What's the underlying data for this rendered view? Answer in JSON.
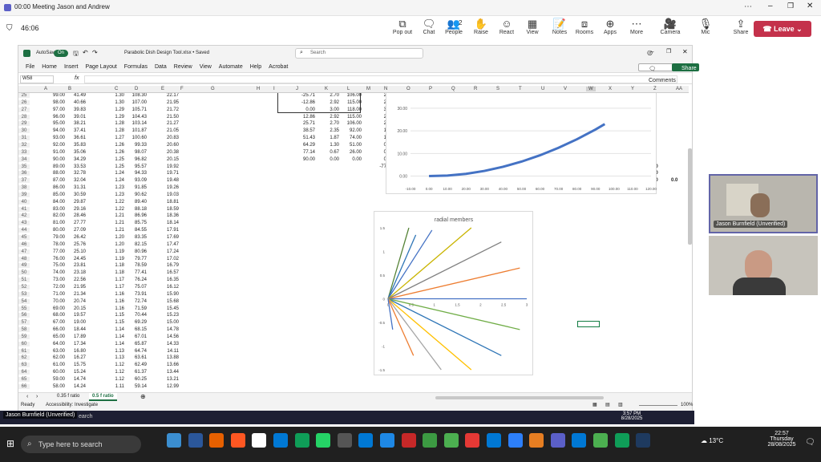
{
  "teams": {
    "title": "00:00 Meeting Jason and Andrew",
    "timer": "46:06",
    "toolbar": [
      {
        "label": "Pop out",
        "icon": "popout-icon"
      },
      {
        "label": "Chat",
        "icon": "chat-icon"
      },
      {
        "label": "People",
        "icon": "people-icon",
        "badge": "2"
      },
      {
        "label": "Raise",
        "icon": "hand-icon"
      },
      {
        "label": "React",
        "icon": "smile-icon"
      },
      {
        "label": "View",
        "icon": "grid-icon"
      },
      {
        "label": "Notes",
        "icon": "notes-icon"
      },
      {
        "label": "Rooms",
        "icon": "rooms-icon"
      },
      {
        "label": "Apps",
        "icon": "apps-icon"
      },
      {
        "label": "More",
        "icon": "more-icon"
      },
      {
        "label": "Camera",
        "icon": "camera-icon"
      },
      {
        "label": "Mic",
        "icon": "mic-icon"
      },
      {
        "label": "Share",
        "icon": "share-icon"
      }
    ],
    "leave_label": "Leave",
    "participants": [
      {
        "name": "Jason Burnfield (Unverified)"
      },
      {
        "name": ""
      }
    ]
  },
  "excel": {
    "autosave": "AutoSave",
    "autosave_state": "On",
    "filename": "Parabolic Dish Design Tool.xlsx • Saved",
    "search_placeholder": "Search",
    "comments_label": "Comments",
    "share_label": "Share",
    "menu": [
      "File",
      "Home",
      "Insert",
      "Page Layout",
      "Formulas",
      "Data",
      "Review",
      "View",
      "Automate",
      "Help",
      "Acrobat"
    ],
    "name_box": "W58",
    "columns": [
      "A",
      "B",
      "C",
      "D",
      "E",
      "F",
      "G",
      "H",
      "I",
      "J",
      "K",
      "L",
      "M",
      "N",
      "O",
      "P",
      "Q",
      "R",
      "S",
      "T",
      "U",
      "V",
      "W",
      "X",
      "Y",
      "Z",
      "AA"
    ],
    "rows": [
      [
        25,
        "99.00",
        "41.49",
        "1.30",
        "108.30",
        "22.17"
      ],
      [
        26,
        "98.00",
        "40.66",
        "1.30",
        "107.00",
        "21.95"
      ],
      [
        27,
        "97.00",
        "39.83",
        "1.29",
        "105.71",
        "21.72"
      ],
      [
        28,
        "96.00",
        "39.01",
        "1.29",
        "104.43",
        "21.50"
      ],
      [
        29,
        "95.00",
        "38.21",
        "1.28",
        "103.14",
        "21.27"
      ],
      [
        30,
        "94.00",
        "37.41",
        "1.28",
        "101.87",
        "21.05"
      ],
      [
        31,
        "93.00",
        "36.61",
        "1.27",
        "100.60",
        "20.83"
      ],
      [
        32,
        "92.00",
        "35.83",
        "1.26",
        "99.33",
        "20.60"
      ],
      [
        33,
        "91.00",
        "35.06",
        "1.26",
        "98.07",
        "20.38"
      ],
      [
        34,
        "90.00",
        "34.29",
        "1.25",
        "96.82",
        "20.15"
      ],
      [
        35,
        "89.00",
        "33.53",
        "1.25",
        "95.57",
        "19.92"
      ],
      [
        36,
        "88.00",
        "32.78",
        "1.24",
        "94.33",
        "19.71"
      ],
      [
        37,
        "87.00",
        "32.04",
        "1.24",
        "93.09",
        "19.48"
      ],
      [
        38,
        "86.00",
        "31.31",
        "1.23",
        "91.85",
        "19.26"
      ],
      [
        39,
        "85.00",
        "30.59",
        "1.23",
        "90.62",
        "19.03"
      ],
      [
        40,
        "84.00",
        "29.87",
        "1.22",
        "89.40",
        "18.81"
      ],
      [
        41,
        "83.00",
        "29.16",
        "1.22",
        "88.18",
        "18.59"
      ],
      [
        42,
        "82.00",
        "28.46",
        "1.21",
        "86.96",
        "18.36"
      ],
      [
        43,
        "81.00",
        "27.77",
        "1.21",
        "85.75",
        "18.14"
      ],
      [
        44,
        "80.00",
        "27.09",
        "1.21",
        "84.55",
        "17.91"
      ],
      [
        45,
        "79.00",
        "26.42",
        "1.20",
        "83.35",
        "17.69"
      ],
      [
        46,
        "78.00",
        "25.76",
        "1.20",
        "82.15",
        "17.47"
      ],
      [
        47,
        "77.00",
        "25.10",
        "1.19",
        "80.96",
        "17.24"
      ],
      [
        48,
        "76.00",
        "24.45",
        "1.19",
        "79.77",
        "17.02"
      ],
      [
        49,
        "75.00",
        "23.81",
        "1.18",
        "78.59",
        "16.79"
      ],
      [
        50,
        "74.00",
        "23.18",
        "1.18",
        "77.41",
        "16.57"
      ],
      [
        51,
        "73.00",
        "22.56",
        "1.17",
        "76.24",
        "16.35"
      ],
      [
        52,
        "72.00",
        "21.95",
        "1.17",
        "75.07",
        "16.12"
      ],
      [
        53,
        "71.00",
        "21.34",
        "1.16",
        "73.91",
        "15.90"
      ],
      [
        54,
        "70.00",
        "20.74",
        "1.16",
        "72.74",
        "15.68"
      ],
      [
        55,
        "69.00",
        "20.15",
        "1.16",
        "71.59",
        "15.45"
      ],
      [
        56,
        "68.00",
        "19.57",
        "1.15",
        "70.44",
        "15.23"
      ],
      [
        57,
        "67.00",
        "19.00",
        "1.15",
        "69.29",
        "15.00"
      ],
      [
        58,
        "66.00",
        "18.44",
        "1.14",
        "68.15",
        "14.78"
      ],
      [
        59,
        "65.00",
        "17.89",
        "1.14",
        "67.01",
        "14.56"
      ],
      [
        60,
        "64.00",
        "17.34",
        "1.14",
        "65.87",
        "14.33"
      ],
      [
        61,
        "63.00",
        "16.80",
        "1.13",
        "64.74",
        "14.11"
      ],
      [
        62,
        "62.00",
        "16.27",
        "1.13",
        "63.61",
        "13.88"
      ],
      [
        63,
        "61.00",
        "15.75",
        "1.12",
        "62.49",
        "13.66"
      ],
      [
        64,
        "60.00",
        "15.24",
        "1.12",
        "61.37",
        "13.44"
      ],
      [
        65,
        "59.00",
        "14.74",
        "1.12",
        "60.25",
        "13.21"
      ],
      [
        66,
        "58.00",
        "14.24",
        "1.11",
        "59.14",
        "12.99"
      ]
    ],
    "table2": [
      [
        "-25.71",
        "2.70",
        "106.00"
      ],
      [
        "-12.86",
        "2.92",
        "115.00"
      ],
      [
        "0.00",
        "3.00",
        "118.00"
      ],
      [
        "12.86",
        "2.92",
        "115.00"
      ],
      [
        "25.71",
        "2.70",
        "106.00"
      ],
      [
        "38.57",
        "2.35",
        "92.00"
      ],
      [
        "51.43",
        "1.87",
        "74.00"
      ],
      [
        "64.29",
        "1.30",
        "51.00"
      ],
      [
        "77.14",
        "0.67",
        "26.00"
      ],
      [
        "90.00",
        "0.00",
        "0.00"
      ]
    ],
    "col_n_values": [
      "2.4",
      "2.4",
      "3.6",
      "2.4",
      "2.4",
      "1.1",
      "1.1",
      "0.5",
      "0.5",
      "0.5",
      "-77.1",
      "",
      "0."
    ],
    "misc_values": {
      "z35": "0.00",
      "z36": "0.00",
      "z37": "3.00",
      "aa37": "0.0"
    },
    "sheets": [
      "0.35 f ratio",
      "0.5 f ratio"
    ],
    "active_sheet": "0.5 f ratio",
    "status_ready": "Ready",
    "status_accessibility": "Accessibility: Investigate",
    "zoom": "100%"
  },
  "chart_data": [
    {
      "type": "line",
      "title": "",
      "x_ticks": [
        "-10.00",
        "0.00",
        "10.00",
        "20.00",
        "30.00",
        "40.00",
        "50.00",
        "60.00",
        "70.00",
        "80.00",
        "90.00",
        "100.00",
        "110.00",
        "120.00"
      ],
      "y_ticks": [
        "0.00",
        "10.00",
        "20.00",
        "30.00"
      ],
      "xlim": [
        -10,
        120
      ],
      "ylim": [
        -3,
        36
      ],
      "series": [
        {
          "name": "",
          "color": "#4472c4",
          "x": [
            0,
            10,
            20,
            30,
            40,
            50,
            60,
            70,
            80,
            90,
            95
          ],
          "y": [
            0,
            0.25,
            1.0,
            2.3,
            4.1,
            6.4,
            9.2,
            12.5,
            16.3,
            20.6,
            23.0
          ]
        }
      ]
    },
    {
      "type": "line",
      "title": "radial members",
      "x_ticks": [
        "0",
        "0.5",
        "1",
        "1.5",
        "2",
        "2.5",
        "3"
      ],
      "y_ticks": [
        "1.5",
        "1",
        "0.5",
        "0",
        "-0.5",
        "-1",
        "-1.5"
      ],
      "xlim": [
        0,
        3
      ],
      "ylim": [
        -1.5,
        1.5
      ],
      "rays": [
        {
          "x": 0.45,
          "y": 1.5,
          "color": "#548235"
        },
        {
          "x": 0.6,
          "y": 1.35,
          "color": "#2e75b6"
        },
        {
          "x": 0.95,
          "y": 1.45,
          "color": "#4472c4"
        },
        {
          "x": 1.8,
          "y": 1.5,
          "color": "#c9b400"
        },
        {
          "x": 2.45,
          "y": 1.2,
          "color": "#7f7f7f"
        },
        {
          "x": 2.85,
          "y": 0.65,
          "color": "#ed7d31"
        },
        {
          "x": 3.0,
          "y": 0.0,
          "color": "#4472c4"
        },
        {
          "x": 2.85,
          "y": -0.65,
          "color": "#70ad47"
        },
        {
          "x": 2.45,
          "y": -1.2,
          "color": "#2e75b6"
        },
        {
          "x": 1.8,
          "y": -1.5,
          "color": "#ffc000"
        },
        {
          "x": 1.15,
          "y": -1.5,
          "color": "#a5a5a5"
        },
        {
          "x": 0.55,
          "y": -1.2,
          "color": "#ed7d31"
        },
        {
          "x": 0.1,
          "y": -0.65,
          "color": "#4472c4"
        }
      ]
    }
  ],
  "windows": {
    "search_placeholder": "Type here to search",
    "weather": "13°C",
    "time": "22:57",
    "day": "Thursday",
    "date": "28/08/2025",
    "remote_time": "3:57 PM",
    "remote_date": "8/28/2025"
  }
}
